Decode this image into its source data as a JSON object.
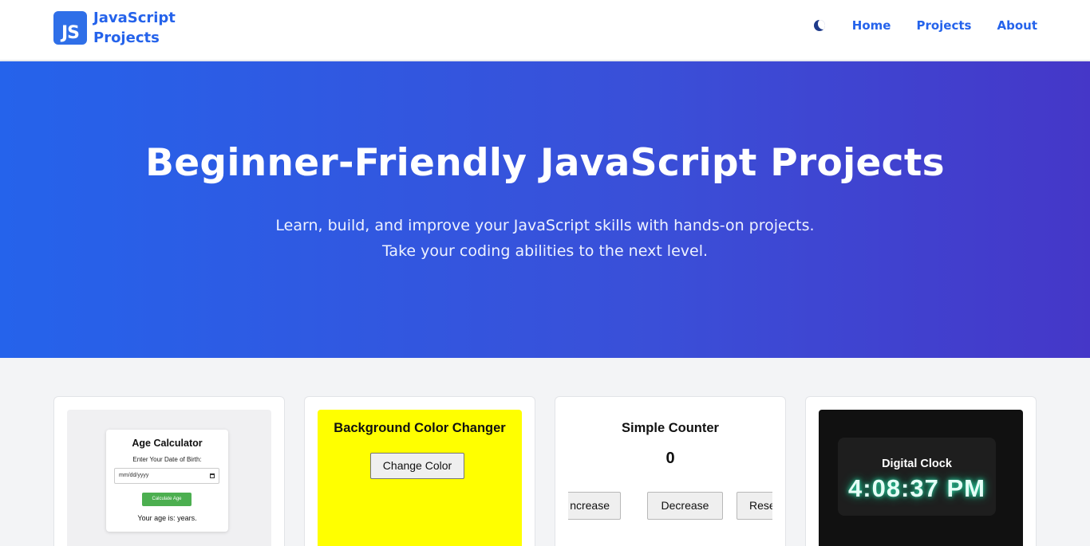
{
  "header": {
    "logo_badge": "JS",
    "logo_line1": "JavaScript",
    "logo_line2": "Projects",
    "nav": [
      {
        "label": "Home"
      },
      {
        "label": "Projects"
      },
      {
        "label": "About"
      }
    ],
    "theme_toggle_icon": "moon-icon"
  },
  "hero": {
    "title": "Beginner-Friendly JavaScript Projects",
    "subtitle": "Learn, build, and improve your JavaScript skills with hands-on projects. Take your coding abilities to the next level."
  },
  "cards": [
    {
      "title": "Age Calculator",
      "label": "Enter Your Date of Birth:",
      "input_placeholder": "mm/dd/yyyy",
      "button": "Calculate Age",
      "result": "Your age is: years."
    },
    {
      "title": "Background Color Changer",
      "button": "Change Color",
      "background": "#ffff00"
    },
    {
      "title": "Simple Counter",
      "value": "0",
      "buttons": [
        "ncrease",
        "Decrease",
        "Reset"
      ]
    },
    {
      "title": "Digital Clock",
      "time": "4:08:37 PM"
    }
  ],
  "colors": {
    "accent": "#2563eb",
    "hero_start": "#2563eb",
    "hero_end": "#4537c8",
    "page_bg": "#f3f4f6"
  }
}
